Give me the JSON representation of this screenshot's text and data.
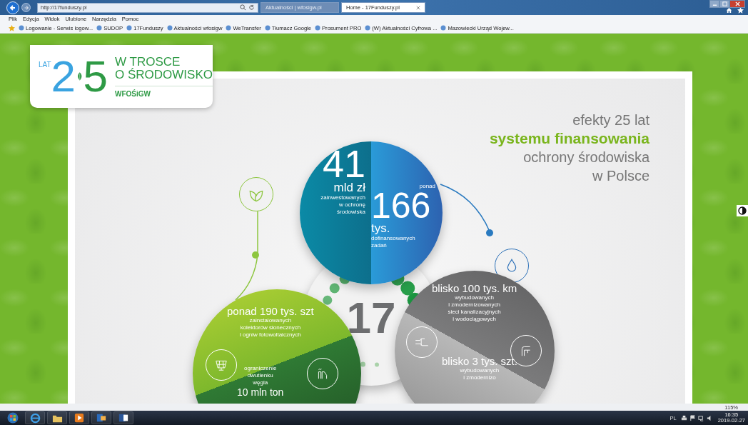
{
  "browser": {
    "address": "http://17funduszy.pl",
    "tabs": [
      {
        "label": "Aktualności | wfosigw.pl",
        "selected": false
      },
      {
        "label": "Home - 17Funduszy.pl",
        "selected": true
      }
    ],
    "menu": [
      "Plik",
      "Edycja",
      "Widok",
      "Ulubione",
      "Narzędzia",
      "Pomoc"
    ],
    "favorites": [
      "Logowanie - Serwis logow...",
      "SUDOP",
      "17Funduszy",
      "Aktualności  wfosigw",
      "WeTransfer",
      "Tłumacz Google",
      "Prosument PRO",
      "(W) Aktualności  Cyfrowa ...",
      "Mazowiecki Urząd Wojew..."
    ]
  },
  "page": {
    "logo": {
      "badge": "LAT",
      "digits": [
        "2",
        "5"
      ],
      "title_lines": [
        "W TROSCE",
        "O ŚRODOWISKO"
      ],
      "org": "WFOŚiGW"
    },
    "headline": [
      {
        "text": "efekty 25 lat",
        "kind": "plain"
      },
      {
        "text": "systemu finansowania",
        "kind": "emphasis"
      },
      {
        "text": "ochrony środowiska",
        "kind": "plain"
      },
      {
        "text": "w Polsce",
        "kind": "plain"
      }
    ],
    "invested": {
      "value": "41",
      "unit": "mld zł",
      "caption": [
        "zainwestowanych",
        "w ochronę",
        "środowiska"
      ]
    },
    "tasks": {
      "prefix": "ponad",
      "value": "166",
      "unit": "tys.",
      "caption": [
        "dofinansowanych",
        "zadań"
      ]
    },
    "center": {
      "value": "17"
    },
    "solar": {
      "headline": "ponad 190 tys. szt",
      "caption": [
        "zainstalowanych",
        "kolektorów słonecznych",
        "i ogniw fotowoltaicznych"
      ]
    },
    "emissions": {
      "caption": [
        "ograniczenie",
        "dwutlenku",
        "węgla"
      ],
      "headline": "10 mln ton"
    },
    "sewers": {
      "headline": "blisko 100 tys. km",
      "caption": [
        "wybudowanych",
        "i zmodernizowanych",
        "sieci kanalizacyjnych",
        "i wodociągowych"
      ]
    },
    "plants": {
      "headline": "blisko 3 tys. szt.",
      "caption": [
        "wybudowanych",
        "i zmodernizo"
      ]
    }
  },
  "status_bar": {
    "zoom": "115%"
  },
  "taskbar": {
    "language": "PL",
    "time": "16:35",
    "date": "2019-02-27"
  }
}
